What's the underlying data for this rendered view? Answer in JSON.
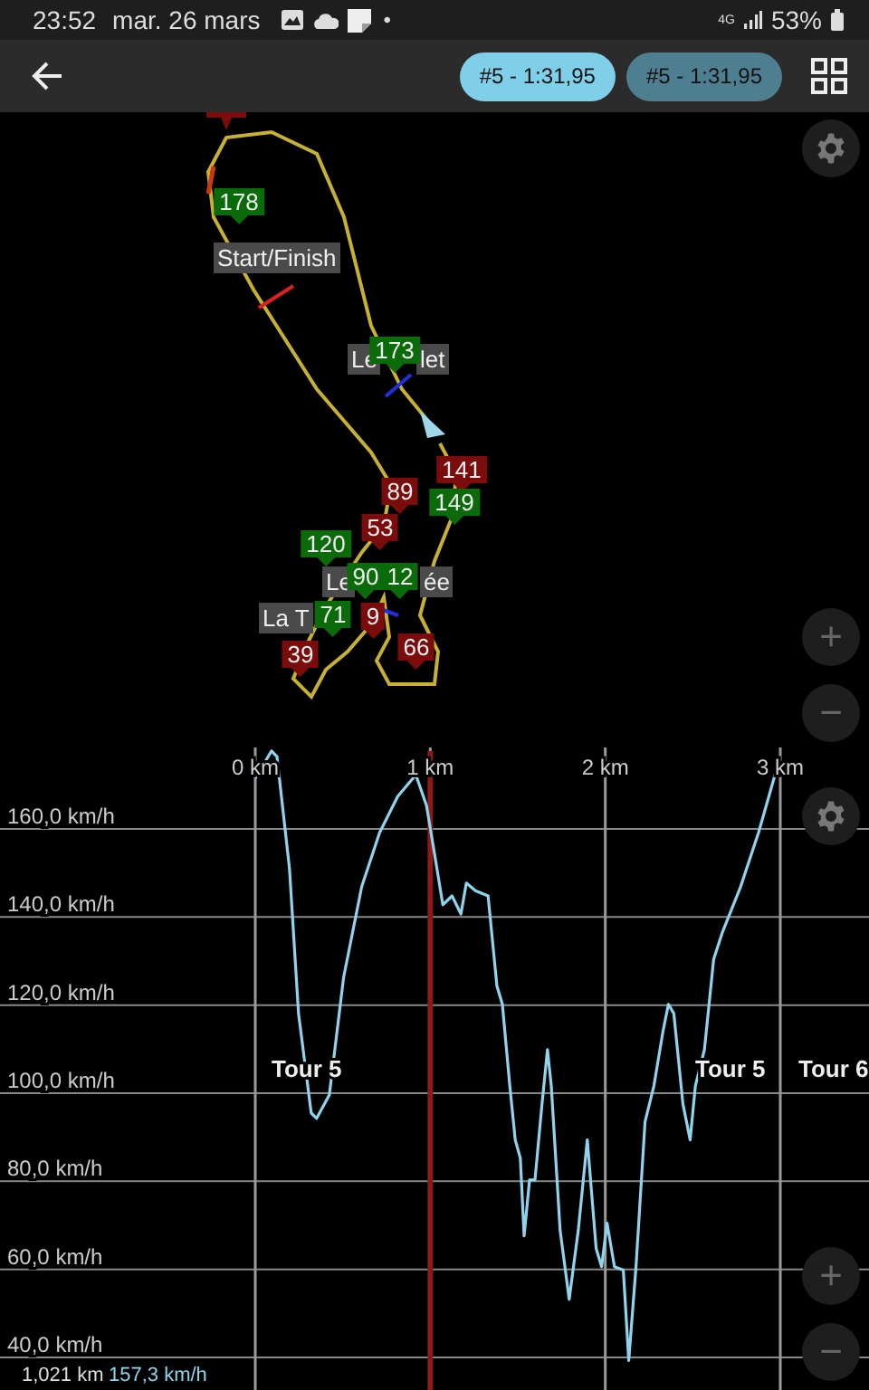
{
  "status_bar": {
    "time": "23:52",
    "date": "mar. 26 mars",
    "dot": "•",
    "network": "4G",
    "battery": "53%"
  },
  "app_bar": {
    "laps": [
      {
        "label": "#5 - 1:31,95",
        "selected": true
      },
      {
        "label": "#5 - 1:31,95",
        "selected": false
      }
    ]
  },
  "map": {
    "markers": [
      {
        "label": "178",
        "color": "#0b6b0b"
      },
      {
        "label": "173",
        "color": "#0b6b0b"
      },
      {
        "label": "141",
        "color": "#7a0c0c"
      },
      {
        "label": "149",
        "color": "#0b6b0b"
      },
      {
        "label": "89",
        "color": "#7a0c0c"
      },
      {
        "label": "53",
        "color": "#7a0c0c"
      },
      {
        "label": "120",
        "color": "#0b6b0b"
      },
      {
        "label": "90",
        "color": "#0b6b0b"
      },
      {
        "label": "12",
        "color": "#0b6b0b"
      },
      {
        "label": "9",
        "color": "#7a0c0c"
      },
      {
        "label": "71",
        "color": "#0b6b0b"
      },
      {
        "label": "39",
        "color": "#7a0c0c"
      },
      {
        "label": "66",
        "color": "#7a0c0c"
      }
    ],
    "labels": [
      "Start/Finish",
      "Le",
      "let",
      "Le",
      "ée",
      "La T"
    ],
    "zoom_in": "+",
    "zoom_out": "−"
  },
  "chart": {
    "zoom_in": "+",
    "zoom_out": "−",
    "readout": {
      "distance": "1,021 km",
      "speed": "157,3 km/h"
    },
    "chart_data": {
      "type": "line",
      "grid": true,
      "xlim": [
        0,
        3
      ],
      "ylim": [
        32.6,
        178.5
      ],
      "xticks": [
        {
          "value": 0,
          "label": "0 km"
        },
        {
          "value": 1,
          "label": "1 km"
        },
        {
          "value": 2,
          "label": "2 km"
        },
        {
          "value": 3,
          "label": "3 km"
        }
      ],
      "yticks": [
        {
          "value": 160,
          "label": "160,0 km/h"
        },
        {
          "value": 140,
          "label": "140,0 km/h"
        },
        {
          "value": 120,
          "label": "120,0 km/h"
        },
        {
          "value": 100,
          "label": "100,0 km/h"
        },
        {
          "value": 80,
          "label": "80,0 km/h"
        },
        {
          "value": 60,
          "label": "60,0 km/h"
        },
        {
          "value": 40,
          "label": "40,0 km/h"
        }
      ],
      "x": [
        0,
        0.093,
        0.124,
        0.196,
        0.247,
        0.32,
        0.351,
        0.423,
        0.505,
        0.608,
        0.711,
        0.814,
        0.918,
        0.979,
        1.021,
        1.072,
        1.124,
        1.175,
        1.206,
        1.258,
        1.33,
        1.381,
        1.412,
        1.454,
        1.485,
        1.515,
        1.536,
        1.567,
        1.598,
        1.639,
        1.67,
        1.691,
        1.742,
        1.794,
        1.845,
        1.897,
        1.948,
        1.979,
        2.01,
        2.052,
        2.103,
        2.134,
        2.175,
        2.227,
        2.278,
        2.33,
        2.361,
        2.392,
        2.443,
        2.485,
        2.515,
        2.567,
        2.619,
        2.67,
        2.773,
        2.876,
        2.979
      ],
      "series": [
        {
          "color": "#8fd3ec",
          "values": [
            171.5,
            177.7,
            176.4,
            151,
            118.1,
            95.5,
            94.3,
            99.6,
            126.3,
            146.9,
            159.2,
            167.4,
            172.3,
            165.3,
            155.1,
            142.8,
            144.8,
            140.7,
            147.7,
            146,
            144.8,
            124.3,
            120.2,
            101.7,
            89.4,
            85.3,
            67.6,
            80.3,
            80.3,
            97.6,
            109.9,
            101.7,
            68.8,
            53.2,
            68.8,
            89.4,
            64.7,
            60.6,
            70.5,
            60.6,
            59.8,
            39.3,
            60.6,
            93.5,
            101.7,
            114,
            120.2,
            118.1,
            97.6,
            89.4,
            101.7,
            109.9,
            130.4,
            136.6,
            146.9,
            159.2,
            173.6
          ]
        }
      ],
      "ref_lines": [
        {
          "axis": "x",
          "value": 1,
          "color": "#8b1a1a"
        }
      ],
      "annotations": [
        "Tour 5",
        "Tour 5",
        "Tour 6"
      ]
    }
  }
}
